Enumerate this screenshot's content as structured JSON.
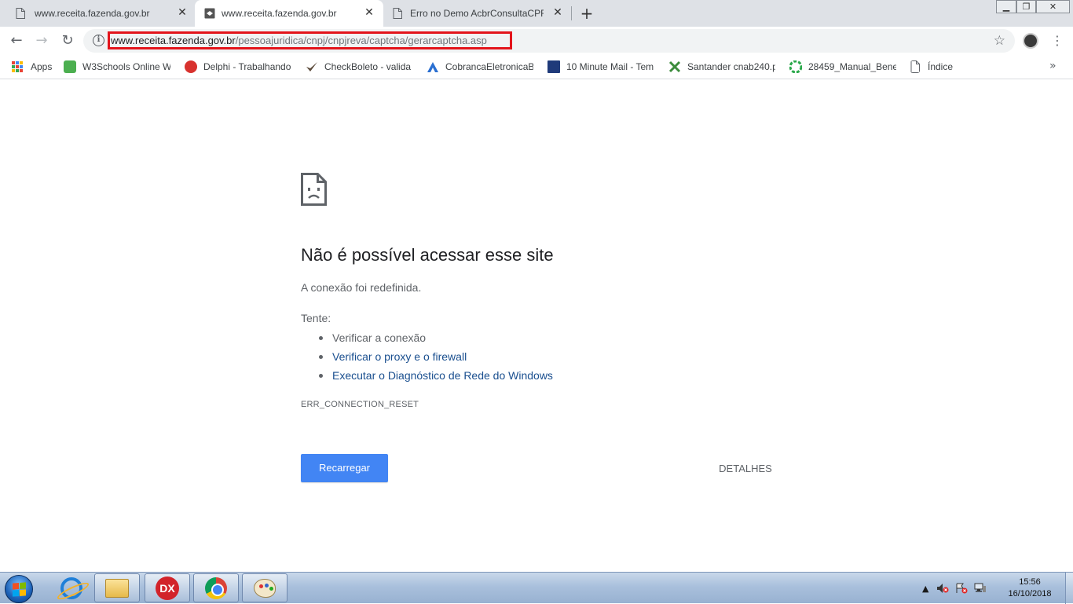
{
  "browser": {
    "tabs": [
      {
        "title": "www.receita.fazenda.gov.br",
        "close": "✕",
        "active": false
      },
      {
        "title": "www.receita.fazenda.gov.br",
        "close": "✕",
        "active": true
      },
      {
        "title": "Erro no Demo AcbrConsultaCPF",
        "close": "✕",
        "active": false
      }
    ],
    "new_tab": "+",
    "window_controls": {
      "minimize": "▁",
      "restore": "❐",
      "close": "✕"
    },
    "nav": {
      "back": "←",
      "forward": "→",
      "reload": "↻"
    },
    "address": {
      "host": "www.receita.fazenda.gov.br",
      "path": "/pessoajuridica/cnpj/cnpjreva/captcha/gerarcaptcha.asp",
      "highlight_color": "#e3141b"
    },
    "star": "☆",
    "menu": "⋮"
  },
  "bookmarks": {
    "items": [
      {
        "label": "Apps",
        "icon": "apps-grid-icon"
      },
      {
        "label": "W3Schools Online W",
        "icon": "w3schools-icon",
        "color": "#4caf50"
      },
      {
        "label": "Delphi - Trabalhando",
        "icon": "delphi-icon",
        "color": "#d8322e"
      },
      {
        "label": "CheckBoleto - valida",
        "icon": "checkmark-icon",
        "color": "#5b4a3a"
      },
      {
        "label": "CobrancaEletronicaB",
        "icon": "bradesco-icon",
        "color": "#2a6fd1"
      },
      {
        "label": "10 Minute Mail - Tem",
        "icon": "mail-icon",
        "color": "#1f3a7a"
      },
      {
        "label": "Santander cnab240.p",
        "icon": "santander-icon",
        "color": "#3c8c3c"
      },
      {
        "label": "28459_Manual_Benef",
        "icon": "pinwheel-icon",
        "color": "#2aa84a"
      },
      {
        "label": "Índice",
        "icon": "page-icon",
        "color": "#777777"
      }
    ],
    "more": "»"
  },
  "error_page": {
    "title": "Não é possível acessar esse site",
    "description": "A conexão foi redefinida.",
    "try_label": "Tente:",
    "suggestions": [
      {
        "text": "Verificar a conexão",
        "is_link": false
      },
      {
        "text": "Verificar o proxy e o firewall",
        "is_link": true
      },
      {
        "text": "Executar o Diagnóstico de Rede do Windows",
        "is_link": true
      }
    ],
    "error_code": "ERR_CONNECTION_RESET",
    "reload_label": "Recarregar",
    "details_label": "DETALHES",
    "accent_color": "#4285f4"
  },
  "taskbar": {
    "items": [
      {
        "name": "internet-explorer"
      },
      {
        "name": "windows-explorer"
      },
      {
        "name": "delphi-xe",
        "label": "DX"
      },
      {
        "name": "google-chrome"
      },
      {
        "name": "paint"
      }
    ],
    "tray": {
      "arrow": "▲"
    },
    "clock": {
      "time": "15:56",
      "date": "16/10/2018"
    }
  }
}
